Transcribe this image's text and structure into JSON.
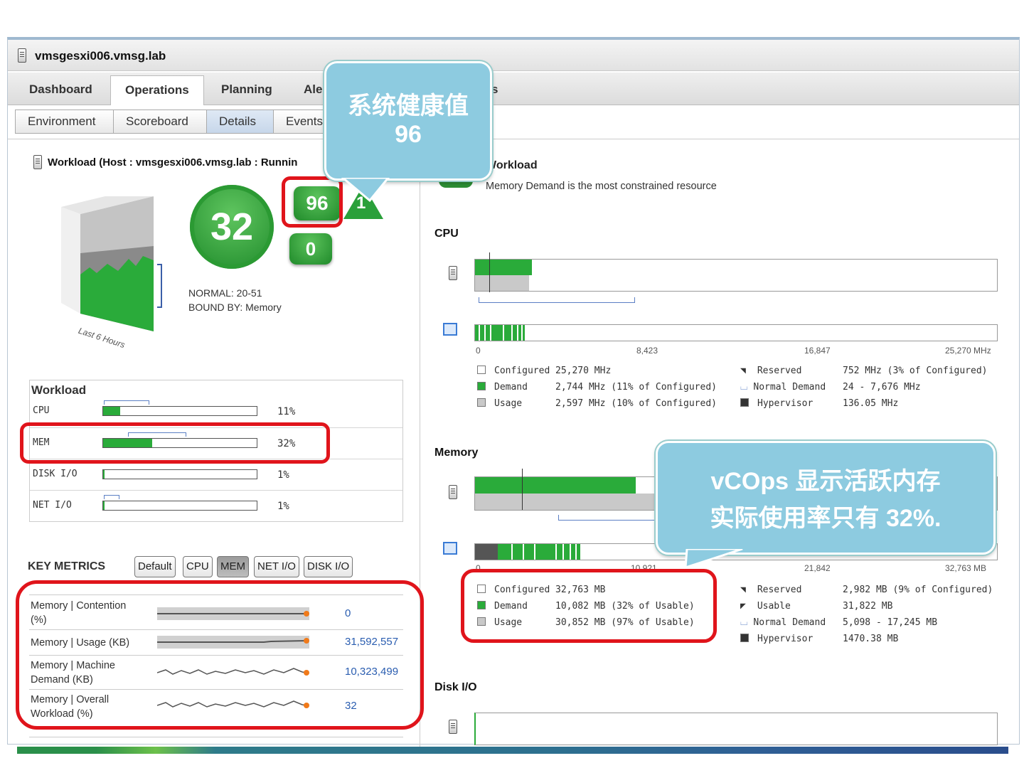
{
  "window": {
    "title": "vmsgesxi006.vmsg.lab"
  },
  "main_tabs": [
    "Dashboard",
    "Operations",
    "Planning",
    "Aler",
    "s"
  ],
  "sub_tabs": [
    "Environment",
    "Scoreboard",
    "Details",
    "Events"
  ],
  "workload_header": "Workload (Host : vmsgesxi006.vmsg.lab : Runnin",
  "badges": {
    "workload": "32",
    "health": "96",
    "anomalies": "1",
    "faults": "0"
  },
  "normal_range": "NORMAL: 20-51",
  "bound_by": "BOUND BY: Memory",
  "last_hours": "Last 6 Hours",
  "workload_table": {
    "title": "Workload",
    "rows": [
      {
        "name": "CPU",
        "pct": "11%",
        "fill": 0.11
      },
      {
        "name": "MEM",
        "pct": "32%",
        "fill": 0.32
      },
      {
        "name": "DISK I/O",
        "pct": "1%",
        "fill": 0.01
      },
      {
        "name": "NET I/O",
        "pct": "1%",
        "fill": 0.01
      }
    ]
  },
  "key_metrics": {
    "title": "KEY METRICS",
    "buttons": [
      "Default",
      "CPU",
      "MEM",
      "NET I/O",
      "DISK I/O"
    ],
    "rows": [
      {
        "name": "Memory | Contention (%)",
        "value": "0"
      },
      {
        "name": "Memory | Usage (KB)",
        "value": "31,592,557"
      },
      {
        "name": "Memory | Machine Demand (KB)",
        "value": "10,323,499"
      },
      {
        "name": "Memory | Overall Workload (%)",
        "value": "32"
      }
    ]
  },
  "right": {
    "header_title": "Workload",
    "header_sub": "Memory Demand is the most constrained resource",
    "cpu": {
      "title": "CPU",
      "ticks": [
        "0",
        "8,423",
        "16,847",
        "25,270 MHz"
      ],
      "legend_left": [
        {
          "label": "Configured",
          "value": "25,270 MHz"
        },
        {
          "label": "Demand",
          "value": "2,744 MHz (11% of Configured)"
        },
        {
          "label": "Usage",
          "value": "2,597 MHz (10% of Configured)"
        }
      ],
      "legend_right": [
        {
          "label": "Reserved",
          "value": "752 MHz (3% of Configured)"
        },
        {
          "label": "Normal Demand",
          "value": "24 - 7,676 MHz"
        },
        {
          "label": "Hypervisor",
          "value": "136.05 MHz"
        }
      ]
    },
    "memory": {
      "title": "Memory",
      "ticks": [
        "0",
        "10,921",
        "21,842",
        "32,763 MB"
      ],
      "legend_left": [
        {
          "label": "Configured",
          "value": "32,763 MB"
        },
        {
          "label": "Demand",
          "value": "10,082 MB (32% of Usable)"
        },
        {
          "label": "Usage",
          "value": "30,852 MB (97% of Usable)"
        }
      ],
      "legend_right": [
        {
          "label": "Reserved",
          "value": "2,982 MB (9% of Configured)"
        },
        {
          "label": "Usable",
          "value": "31,822 MB"
        },
        {
          "label": "Normal Demand",
          "value": "5,098 - 17,245 MB"
        },
        {
          "label": "Hypervisor",
          "value": "1470.38 MB"
        }
      ]
    },
    "disk": {
      "title": "Disk I/O"
    }
  },
  "callouts": {
    "health_line1": "系统健康值",
    "health_line2": "96",
    "mem_line1": "vCOps 显示活跃内存",
    "mem_line2": "实际使用率只有 32%."
  },
  "colors": {
    "green": "#2aab3a",
    "callout": "#8dcbe0",
    "highlight": "#e0141b"
  }
}
